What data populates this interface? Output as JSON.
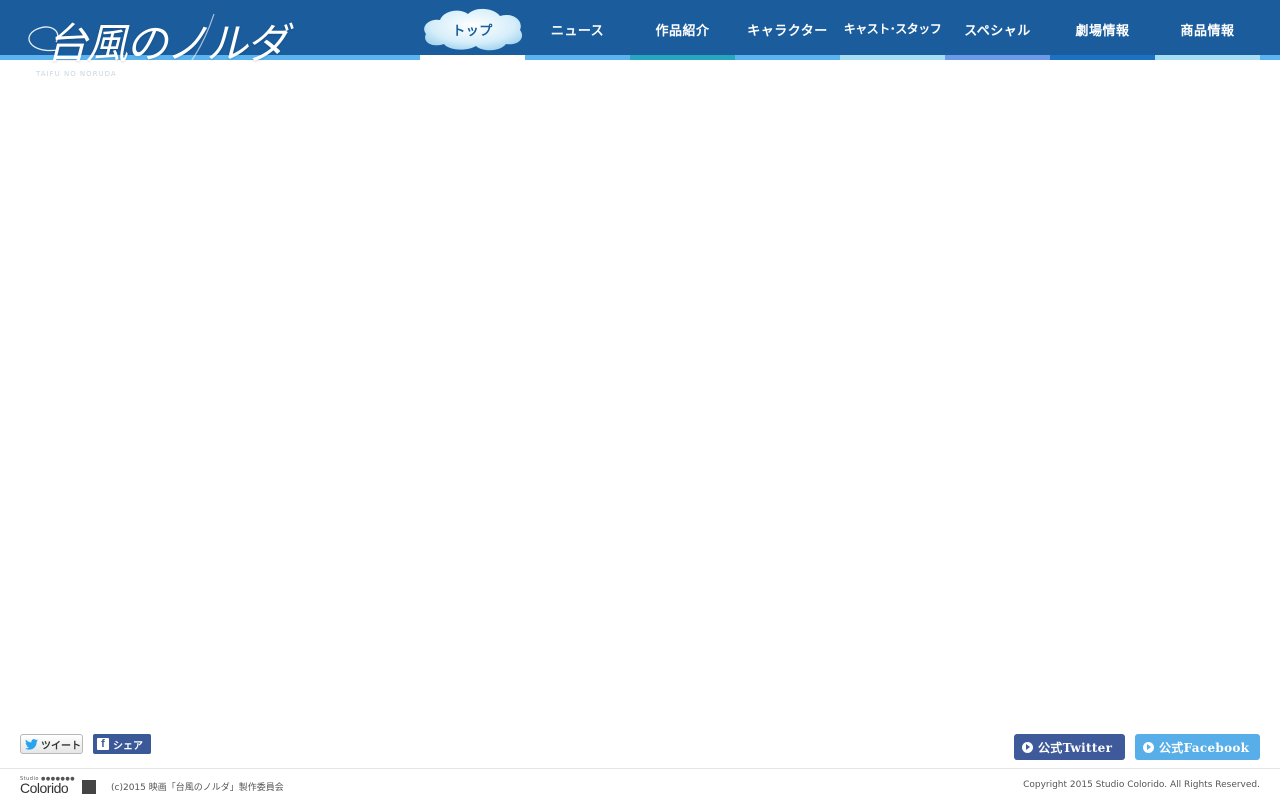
{
  "logo": {
    "title": "台風のノルダ",
    "subtitle": "TAIFU NO NORUDA"
  },
  "nav": {
    "items": [
      {
        "label": "トップ",
        "bar_color": "#ffffff",
        "active": true
      },
      {
        "label": "ニュース",
        "bar_color": "#5bb4ef",
        "active": false
      },
      {
        "label": "作品紹介",
        "bar_color": "#26a7bf",
        "active": false
      },
      {
        "label": "キャラクター",
        "bar_color": "#5bb4ef",
        "active": false
      },
      {
        "label": "キャスト･スタッフ",
        "bar_color": "#a6dff2",
        "active": false
      },
      {
        "label": "スペシャル",
        "bar_color": "#6b9be8",
        "active": false
      },
      {
        "label": "劇場情報",
        "bar_color": "#1b72c4",
        "active": false
      },
      {
        "label": "商品情報",
        "bar_color": "#a6dff2",
        "active": false
      }
    ]
  },
  "share": {
    "tweet_label": "ツイート",
    "facebook_label": "シェア",
    "facebook_icon": "f"
  },
  "official": {
    "twitter_label": "公式Twitter",
    "facebook_label": "公式Facebook"
  },
  "footer": {
    "studio_small": "Studio ●●●●●●●",
    "studio_name": "Colorido",
    "copyright_left": "(c)2015 映画「台風のノルダ」製作委員会",
    "copyright_right": "Copyright 2015 Studio Colorido. All Rights Reserved."
  },
  "colors": {
    "header": "#1a5c9c",
    "stripe": "#5bb4ef",
    "official_twitter": "#3f5a9a",
    "official_facebook": "#58aee8"
  }
}
